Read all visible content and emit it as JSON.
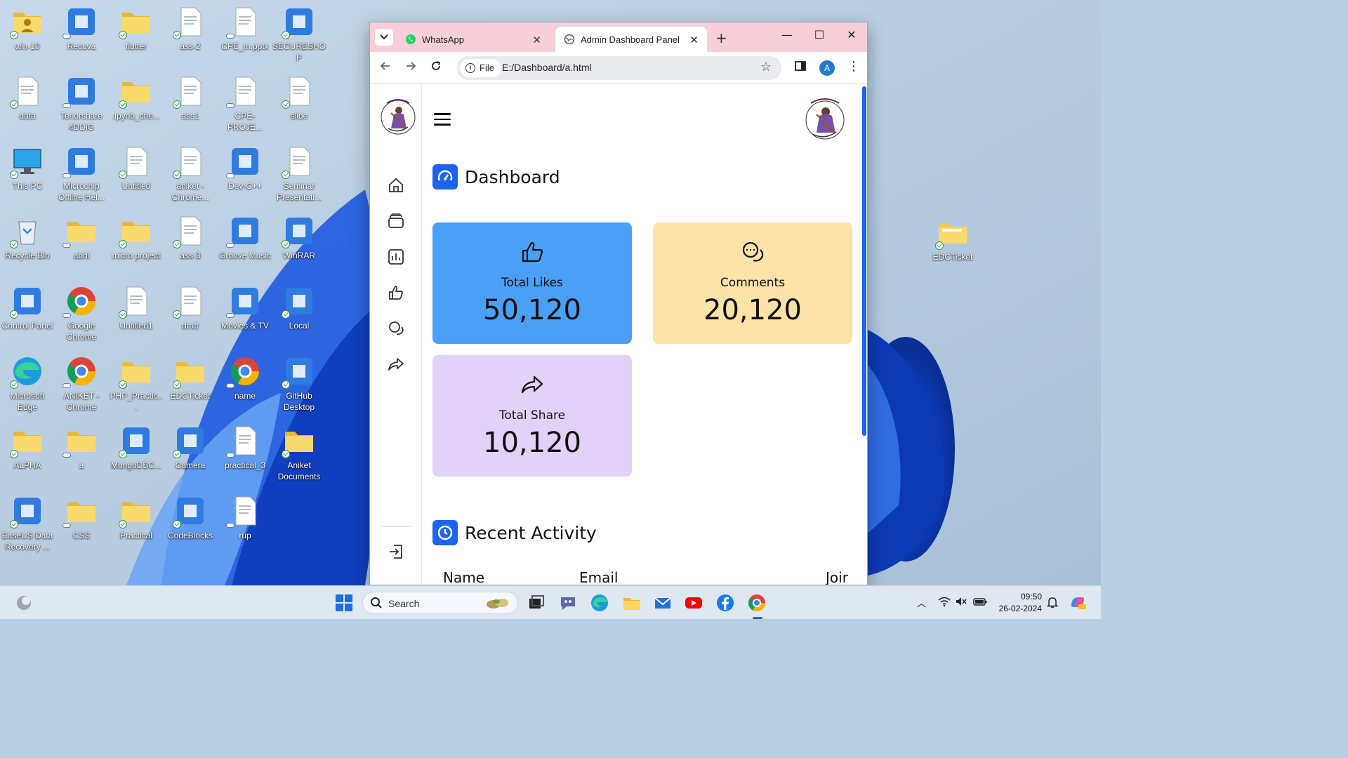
{
  "desktop": {
    "icons": [
      {
        "label": "win-10"
      },
      {
        "label": "Recuva"
      },
      {
        "label": "flutter"
      },
      {
        "label": "ass-2"
      },
      {
        "label": "CPE_m.pptx"
      },
      {
        "label": "SECURESHOP"
      },
      {
        "label": "data"
      },
      {
        "label": "Tenorshare 4DDiG"
      },
      {
        "label": ".ipynb_che..."
      },
      {
        "label": "ass1"
      },
      {
        "label": "CPE-PROJE..."
      },
      {
        "label": "slide"
      },
      {
        "label": "This PC"
      },
      {
        "label": "Microchip Offline Hel..."
      },
      {
        "label": "Untitled"
      },
      {
        "label": "aniket - Chrome..."
      },
      {
        "label": "Dev-C++"
      },
      {
        "label": "Seminar Presentati..."
      },
      {
        "label": "Recycle Bin"
      },
      {
        "label": "abhi"
      },
      {
        "label": "micro project"
      },
      {
        "label": "ass-3"
      },
      {
        "label": "Groove Music"
      },
      {
        "label": "WinRAR"
      },
      {
        "label": "Control Panel"
      },
      {
        "label": "Google Chrome"
      },
      {
        "label": "Untitled1"
      },
      {
        "label": "draft"
      },
      {
        "label": "Movies & TV"
      },
      {
        "label": "Local"
      },
      {
        "label": "Microsoft Edge"
      },
      {
        "label": "ANIKET - Chrome"
      },
      {
        "label": "PHP_Practic..."
      },
      {
        "label": "EDCTicket"
      },
      {
        "label": "name"
      },
      {
        "label": "GitHub Desktop"
      },
      {
        "label": "ALPHA"
      },
      {
        "label": "a"
      },
      {
        "label": "MongoDBC..."
      },
      {
        "label": "Camera"
      },
      {
        "label": "practical_3"
      },
      {
        "label": "Aniket Documents"
      },
      {
        "label": "EaseUS Data Recovery ..."
      },
      {
        "label": "CSS"
      },
      {
        "label": "Practical"
      },
      {
        "label": "CodeBlocks"
      },
      {
        "label": "rup"
      }
    ],
    "right_icon": {
      "label": "EDCTicket"
    }
  },
  "browser": {
    "tabs": [
      {
        "title": "WhatsApp",
        "active": false
      },
      {
        "title": "Admin Dashboard Panel",
        "active": true
      }
    ],
    "address": {
      "scheme_chip": "File",
      "url": "E:/Dashboard/a.html"
    },
    "profile_initial": "A",
    "page": {
      "dashboard_title": "Dashboard",
      "cards": {
        "likes": {
          "label": "Total Likes",
          "value": "50,120",
          "color": "#4aa0f6",
          "icon": "thumbs-up-icon"
        },
        "comments": {
          "label": "Comments",
          "value": "20,120",
          "color": "#fde3a8",
          "icon": "comments-icon"
        },
        "share": {
          "label": "Total Share",
          "value": "10,120",
          "color": "#e2d1f9",
          "icon": "share-icon"
        }
      },
      "recent_activity_title": "Recent Activity",
      "table_headers": [
        "Name",
        "Email",
        "Joir"
      ],
      "sidebar_icons": [
        "home-icon",
        "files-icon",
        "analytics-icon",
        "likes-icon",
        "comments-icon",
        "share-icon",
        "logout-icon"
      ],
      "accent": "#1b63f0"
    }
  },
  "taskbar": {
    "search_placeholder": "Search",
    "time": "09:50",
    "date": "26-02-2024"
  }
}
